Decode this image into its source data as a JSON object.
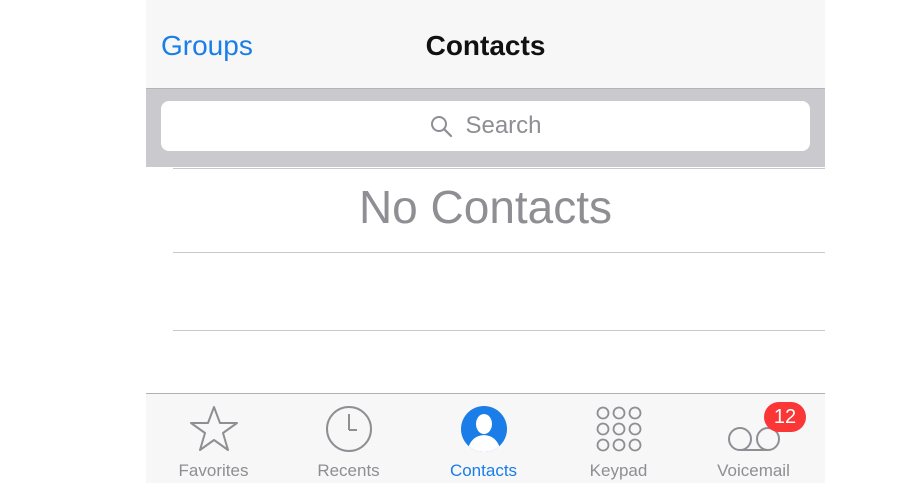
{
  "navbar": {
    "left_label": "Groups",
    "title": "Contacts"
  },
  "search": {
    "placeholder": "Search"
  },
  "empty_state": {
    "text": "No Contacts"
  },
  "tabbar": {
    "tabs": [
      {
        "label": "Favorites",
        "icon": "star-icon",
        "active": false
      },
      {
        "label": "Recents",
        "icon": "clock-icon",
        "active": false
      },
      {
        "label": "Contacts",
        "icon": "person-icon",
        "active": true
      },
      {
        "label": "Keypad",
        "icon": "keypad-icon",
        "active": false
      },
      {
        "label": "Voicemail",
        "icon": "voicemail-icon",
        "active": false,
        "badge": "12"
      }
    ]
  },
  "colors": {
    "accent": "#1a7de8",
    "badge": "#fb3636",
    "inactive": "#8e8e93"
  }
}
